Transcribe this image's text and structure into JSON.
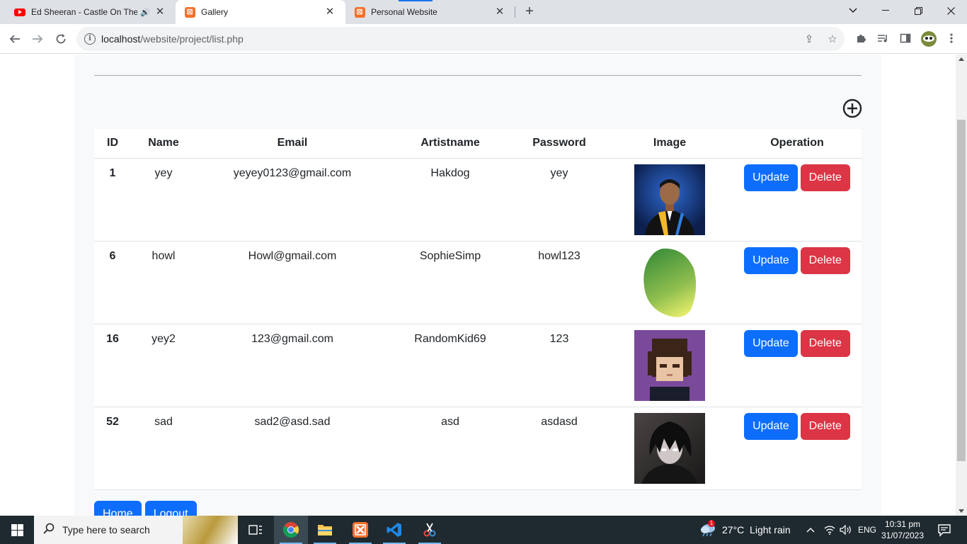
{
  "browser": {
    "tabs": [
      {
        "title": "Ed Sheeran - Castle On The H",
        "favicon": "youtube-icon",
        "audio": true
      },
      {
        "title": "Gallery",
        "favicon": "xampp-icon",
        "active": true
      },
      {
        "title": "Personal Website",
        "favicon": "xampp-icon"
      }
    ],
    "new_tab_label": "+",
    "url_host": "localhost",
    "url_path": "/website/project/list.php"
  },
  "page": {
    "add_icon": "plus-circle-icon",
    "table": {
      "headers": [
        "ID",
        "Name",
        "Email",
        "Artistname",
        "Password",
        "Image",
        "Operation"
      ],
      "rows": [
        {
          "id": "1",
          "name": "yey",
          "email": "yeyey0123@gmail.com",
          "artistname": "Hakdog",
          "password": "yey",
          "image": "graduation-portrait",
          "update": "Update",
          "delete": "Delete"
        },
        {
          "id": "6",
          "name": "howl",
          "email": "Howl@gmail.com",
          "artistname": "SophieSimp",
          "password": "howl123",
          "image": "mango",
          "update": "Update",
          "delete": "Delete"
        },
        {
          "id": "16",
          "name": "yey2",
          "email": "123@gmail.com",
          "artistname": "RandomKid69",
          "password": "123",
          "image": "pixel-avatar",
          "update": "Update",
          "delete": "Delete"
        },
        {
          "id": "52",
          "name": "sad",
          "email": "sad2@asd.sad",
          "artistname": "asd",
          "password": "asdasd",
          "image": "anime-character",
          "update": "Update",
          "delete": "Delete"
        }
      ]
    },
    "home_button": "Home",
    "logout_button": "Logout",
    "colors": {
      "primary": "#0d6efd",
      "danger": "#dc3545",
      "panel": "#f8f9fa"
    }
  },
  "taskbar": {
    "search_placeholder": "Type here to search",
    "weather": "27°C  Light rain",
    "language": "ENG",
    "time": "10:31 pm",
    "date": "31/07/2023",
    "weather_badge": "1"
  }
}
